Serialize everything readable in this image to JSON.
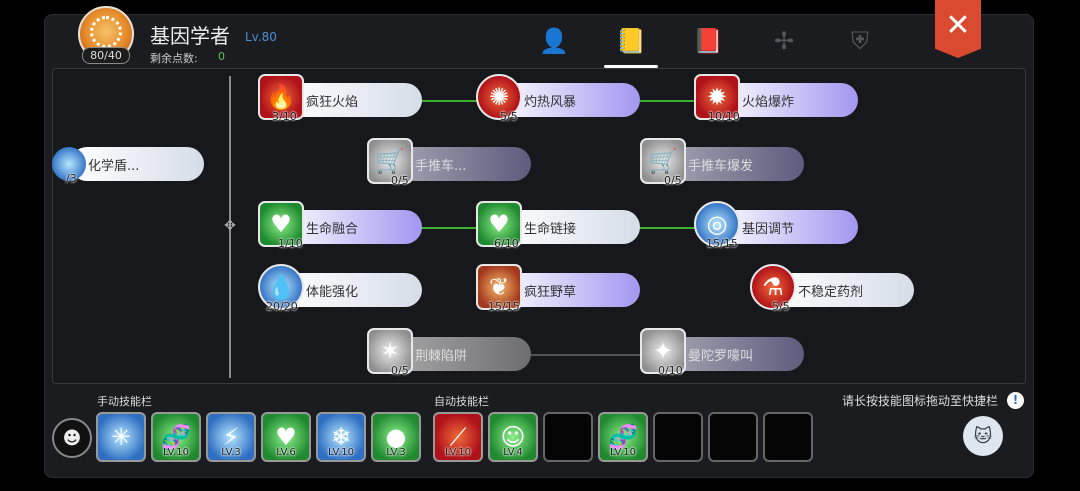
{
  "header": {
    "class_name": "基因学者",
    "level": "Lv.80",
    "avatar_count": "80/40",
    "points_label": "剩余点数:",
    "points_value": "0",
    "tabs": [
      {
        "name": "character-tab",
        "icon": "person-star-icon"
      },
      {
        "name": "skill-book-tab",
        "icon": "skill-book-icon",
        "active": true
      },
      {
        "name": "book-tab",
        "icon": "book-icon"
      },
      {
        "name": "cross-tab",
        "icon": "cross-icon"
      },
      {
        "name": "emblem-tab",
        "icon": "winged-emblem-icon"
      }
    ],
    "close": "✕"
  },
  "tree": {
    "root": {
      "label": "化学盾...",
      "level": "/3"
    },
    "skills": [
      {
        "id": "frenzy-flame",
        "label": "疯狂火焰",
        "level": "3/10",
        "style": "white",
        "icon": "flame-icon"
      },
      {
        "id": "scorch-storm",
        "label": "灼热风暴",
        "level": "5/5",
        "style": "purple",
        "icon": "fire-swirl-icon"
      },
      {
        "id": "flame-burst",
        "label": "火焰爆炸",
        "level": "10/10",
        "style": "purple",
        "icon": "explosion-icon"
      },
      {
        "id": "cart",
        "label": "手推车...",
        "level": "0/5",
        "style": "locked",
        "icon": "cart-icon"
      },
      {
        "id": "cart-burst",
        "label": "手推车爆发",
        "level": "0/5",
        "style": "locked",
        "icon": "cart-burst-icon"
      },
      {
        "id": "life-fusion",
        "label": "生命融合",
        "level": "1/10",
        "style": "purple",
        "icon": "heart-leaf-icon"
      },
      {
        "id": "life-link",
        "label": "生命链接",
        "level": "6/10",
        "style": "white",
        "icon": "heart-link-icon"
      },
      {
        "id": "gene-tune",
        "label": "基因调节",
        "level": "15/15",
        "style": "purple",
        "icon": "gene-orb-icon"
      },
      {
        "id": "stamina",
        "label": "体能强化",
        "level": "20/20",
        "style": "white",
        "icon": "water-drop-icon"
      },
      {
        "id": "wild-weed",
        "label": "疯狂野草",
        "level": "15/15",
        "style": "purple",
        "icon": "weed-icon"
      },
      {
        "id": "unstable-potion",
        "label": "不稳定药剂",
        "level": "5/5",
        "style": "white",
        "icon": "potion-icon"
      },
      {
        "id": "thorn-trap",
        "label": "荆棘陷阱",
        "level": "0/5",
        "style": "lockedgray",
        "icon": "thorn-icon"
      },
      {
        "id": "mandrake-cry",
        "label": "曼陀罗嚎叫",
        "level": "0/10",
        "style": "locked",
        "icon": "mandrake-icon"
      }
    ]
  },
  "manual_bar": {
    "title": "手动技能栏",
    "slots": [
      {
        "icon": "shield-burst-icon",
        "level": ""
      },
      {
        "icon": "dna-icon",
        "level": "LV.10"
      },
      {
        "icon": "light-beam-icon",
        "level": "LV.3"
      },
      {
        "icon": "heart-leaf-icon",
        "level": "LV.6"
      },
      {
        "icon": "frost-icon",
        "level": "LV.10"
      },
      {
        "icon": "figure-icon",
        "level": "LV.3"
      }
    ]
  },
  "auto_bar": {
    "title": "自动技能栏",
    "slots": [
      {
        "icon": "slash-icon",
        "level": "LV.10"
      },
      {
        "icon": "angel-icon",
        "level": "LV.4"
      },
      {
        "icon": "",
        "level": ""
      },
      {
        "icon": "dna-icon",
        "level": "LV.10"
      },
      {
        "icon": "",
        "level": ""
      },
      {
        "icon": "",
        "level": ""
      },
      {
        "icon": "",
        "level": ""
      }
    ]
  },
  "hint": "请长按技能图标拖动至快捷栏",
  "hint_icon": "!",
  "colors": {
    "accent_blue": "#4a8fd6",
    "link_green": "#3fae30",
    "close_red": "#d94a30"
  }
}
